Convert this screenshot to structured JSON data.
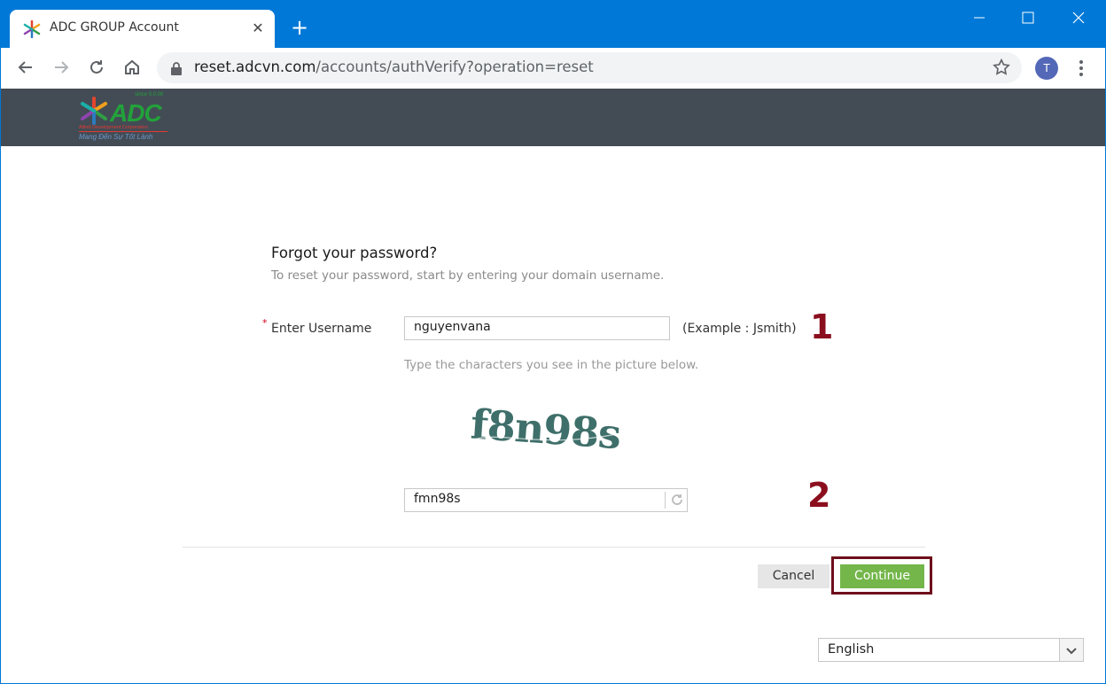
{
  "browser": {
    "tab_title": "ADC GROUP Account",
    "url_host": "reset.adcvn.com",
    "url_path": "/accounts/authVerify?operation=reset",
    "avatar_initial": "T"
  },
  "header": {
    "logo_text": "ADC",
    "logo_since": "since 0.0.00",
    "logo_sub": "Allied Development Corporation",
    "logo_slogan": "Mang Đến Sự Tốt Lành"
  },
  "form": {
    "title": "Forgot your password?",
    "subtitle": "To reset your password, start by entering your domain username.",
    "required_mark": "*",
    "username_label": "Enter Username",
    "username_value": "nguyenvana",
    "username_example": "(Example : Jsmith)",
    "captcha_hint": "Type the characters you see in the picture below.",
    "captcha_text": "f8n98s",
    "captcha_value": "fmn98s",
    "cancel_label": "Cancel",
    "continue_label": "Continue"
  },
  "annotations": {
    "marker_1": "1",
    "marker_2": "2"
  },
  "language": {
    "selected": "English"
  },
  "colors": {
    "titlebar": "#0078d7",
    "site_header": "#434c55",
    "continue_button": "#74b64a",
    "annotation": "#8b0e1e"
  }
}
